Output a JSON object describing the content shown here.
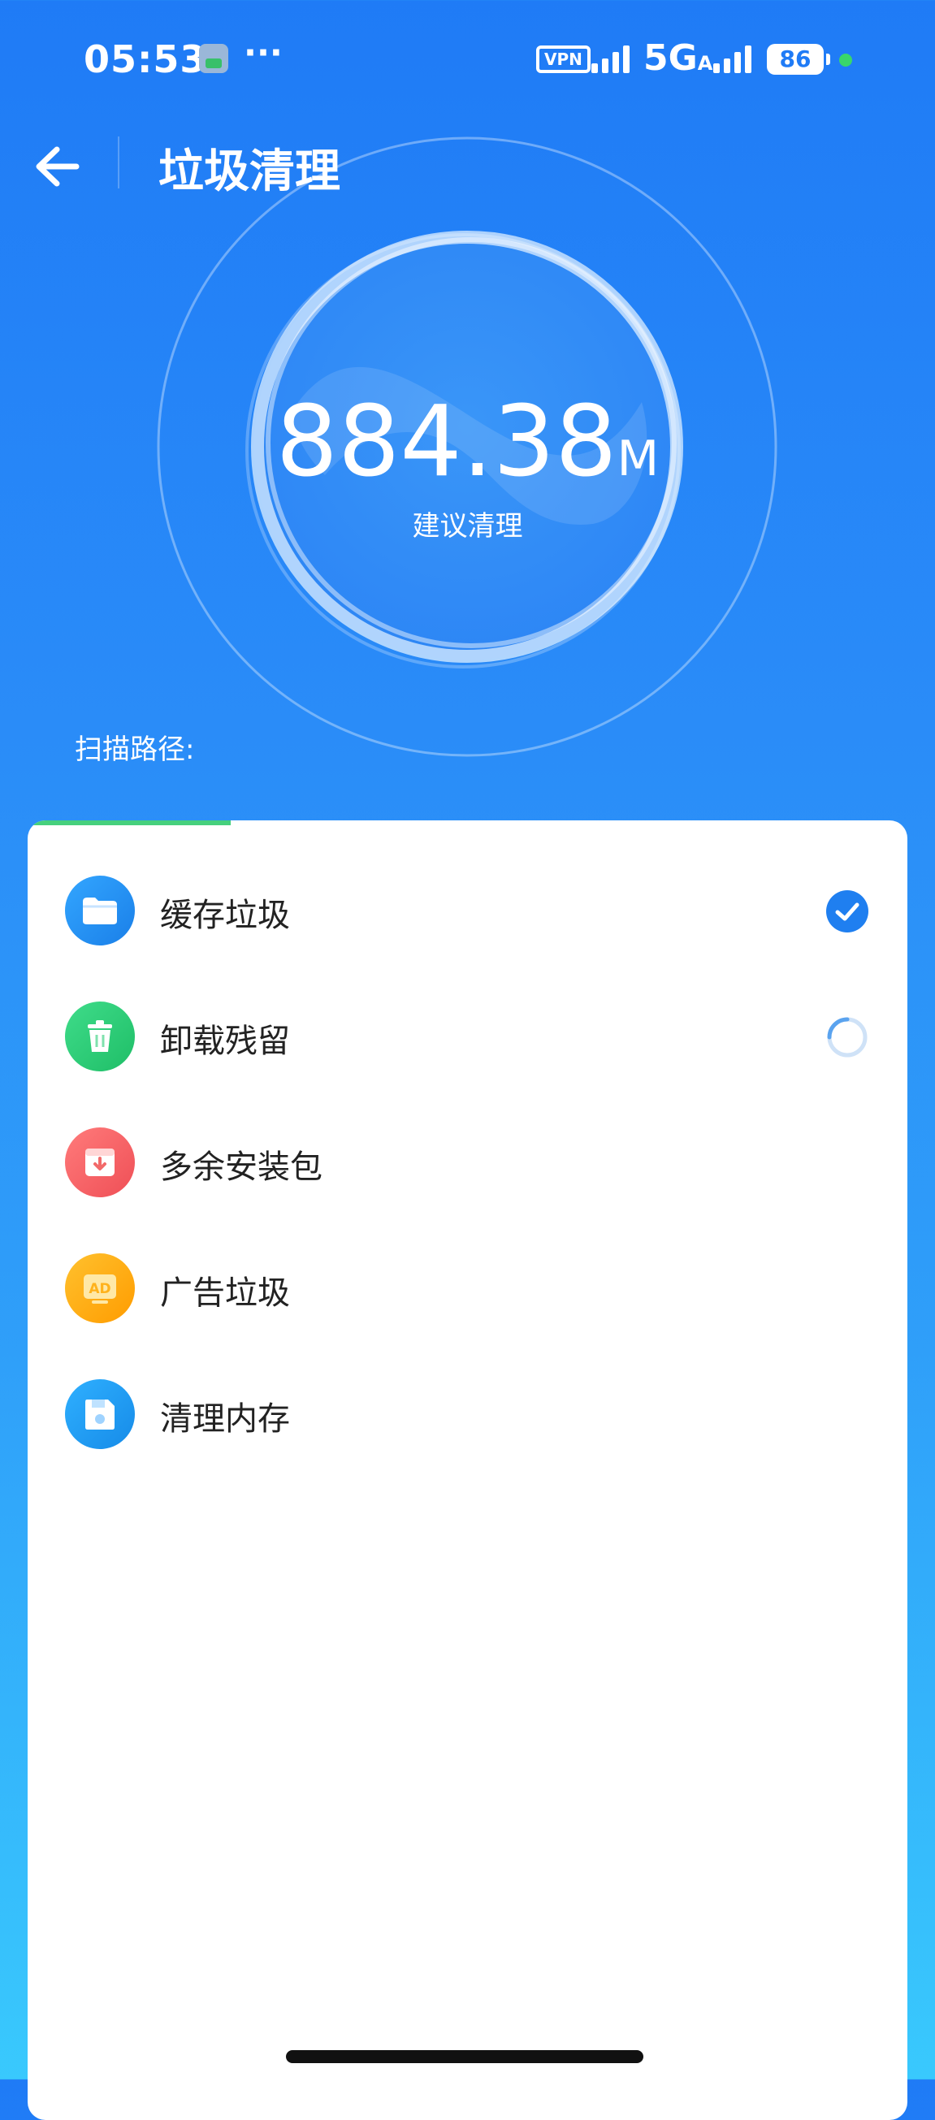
{
  "status_bar": {
    "time": "05:53",
    "more": "···",
    "vpn": "VPN",
    "network": "5G",
    "network_sub": "A",
    "battery": "86"
  },
  "header": {
    "title": "垃圾清理"
  },
  "summary": {
    "size_value": "884.38",
    "size_unit": "M",
    "hint": "建议清理"
  },
  "scan": {
    "path_label": "扫描路径:"
  },
  "colors": {
    "accent": "#1f7bf6",
    "done_check": "#1f7ff0",
    "progress": "#46d07d"
  },
  "scan_items": [
    {
      "label": "缓存垃圾",
      "icon": "folder-icon",
      "status": "done"
    },
    {
      "label": "卸载残留",
      "icon": "trash-icon",
      "status": "scanning"
    },
    {
      "label": "多余安装包",
      "icon": "package-icon",
      "status": "pending"
    },
    {
      "label": "广告垃圾",
      "icon": "ad-icon",
      "status": "pending"
    },
    {
      "label": "清理内存",
      "icon": "memory-icon",
      "status": "pending"
    }
  ]
}
